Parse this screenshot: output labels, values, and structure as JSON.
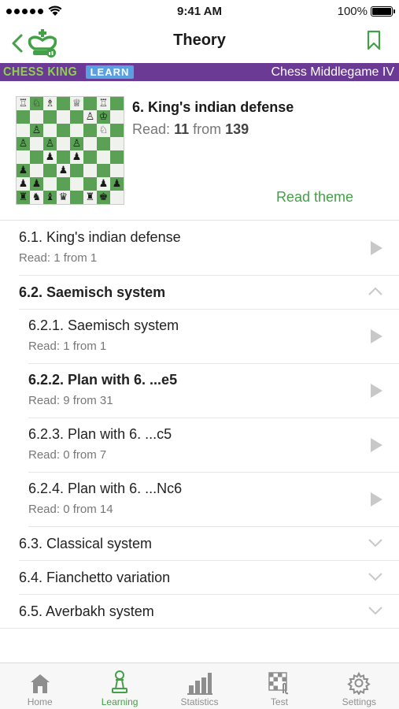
{
  "status_bar": {
    "time": "9:41 AM",
    "battery": "100%"
  },
  "nav": {
    "title": "Theory"
  },
  "banner": {
    "brand": "CHESS KING",
    "learn": "LEARN",
    "course": "Chess Middlegame IV"
  },
  "theme": {
    "title": "6. King's indian defense",
    "read_prefix": "Read:",
    "read_count": "11",
    "read_mid": "from",
    "read_total": "139",
    "read_theme_label": "Read theme"
  },
  "board": [
    [
      "♖",
      "♘",
      "♗",
      "",
      "♕",
      "",
      "♖",
      ""
    ],
    [
      "",
      "",
      "",
      "",
      "",
      "♙",
      "♔",
      ""
    ],
    [
      "",
      "♙",
      "",
      "",
      "",
      "",
      "♘",
      ""
    ],
    [
      "♙",
      "",
      "♙",
      "",
      "♙",
      "",
      "",
      ""
    ],
    [
      "",
      "",
      "♟",
      "",
      "♟",
      "",
      "",
      ""
    ],
    [
      "♟",
      "",
      "",
      "♟",
      "",
      "",
      "",
      ""
    ],
    [
      "♟",
      "♟",
      "",
      "",
      "",
      "",
      "♟",
      "♟"
    ],
    [
      "♜",
      "♞",
      "♝",
      "♛",
      "",
      "♜",
      "♚",
      ""
    ]
  ],
  "items": [
    {
      "title": "6.1. King's indian defense",
      "sub": "Read: 1 from 1",
      "icon": "play-icon"
    },
    {
      "title": "6.2. Saemisch system",
      "icon": "chevron-up-icon"
    },
    {
      "title": "6.2.1. Saemisch system",
      "sub": "Read: 1 from 1",
      "icon": "play-icon"
    },
    {
      "title": "6.2.2. Plan with 6. ...e5",
      "sub": "Read: 9 from 31",
      "icon": "play-icon"
    },
    {
      "title": "6.2.3. Plan with 6. ...c5",
      "sub": "Read: 0 from 7",
      "icon": "play-icon"
    },
    {
      "title": "6.2.4. Plan with 6. ...Nc6",
      "sub": "Read: 0 from 14",
      "icon": "play-icon"
    },
    {
      "title": "6.3. Classical system",
      "icon": "chevron-down-icon"
    },
    {
      "title": "6.4. Fianchetto variation",
      "icon": "chevron-down-icon"
    },
    {
      "title": "6.5. Averbakh system",
      "icon": "chevron-down-icon"
    }
  ],
  "tabs": [
    {
      "label": "Home",
      "icon": "home-icon"
    },
    {
      "label": "Learning",
      "icon": "pawn-icon",
      "active": true
    },
    {
      "label": "Statistics",
      "icon": "bar-chart-icon"
    },
    {
      "label": "Test",
      "icon": "test-board-icon"
    },
    {
      "label": "Settings",
      "icon": "gear-icon"
    }
  ],
  "colors": {
    "accent": "#43a047",
    "banner": "#6a3a94",
    "brand_green": "#8fd14f",
    "learn_blue": "#5aa0e0"
  }
}
